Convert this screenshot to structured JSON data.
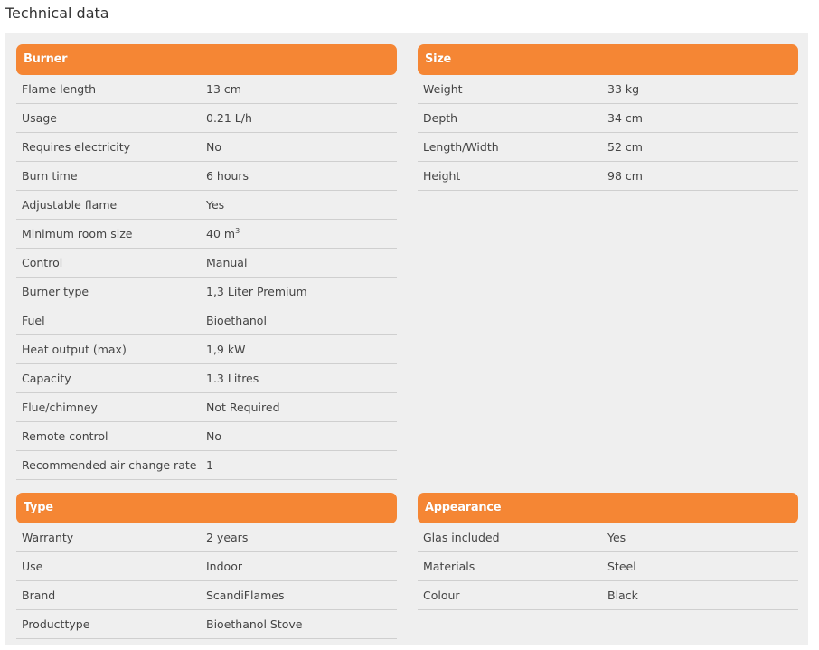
{
  "page": {
    "title": "Technical data"
  },
  "sections": {
    "burner": {
      "title": "Burner",
      "rows": [
        {
          "label": "Flame length",
          "value": "13 cm"
        },
        {
          "label": "Usage",
          "value": "0.21 L/h"
        },
        {
          "label": "Requires electricity",
          "value": "No"
        },
        {
          "label": "Burn time",
          "value": "6 hours"
        },
        {
          "label": "Adjustable flame",
          "value": "Yes"
        },
        {
          "label": "Minimum room size",
          "value": "40 m",
          "sup": "3"
        },
        {
          "label": "Control",
          "value": "Manual"
        },
        {
          "label": "Burner type",
          "value": "1,3 Liter Premium"
        },
        {
          "label": "Fuel",
          "value": "Bioethanol"
        },
        {
          "label": "Heat output (max)",
          "value": "1,9 kW"
        },
        {
          "label": "Capacity",
          "value": "1.3 Litres"
        },
        {
          "label": "Flue/chimney",
          "value": "Not Required"
        },
        {
          "label": "Remote control",
          "value": "No"
        },
        {
          "label": "Recommended air change rate",
          "value": "1"
        }
      ]
    },
    "size": {
      "title": "Size",
      "rows": [
        {
          "label": "Weight",
          "value": "33 kg"
        },
        {
          "label": "Depth",
          "value": "34 cm"
        },
        {
          "label": "Length/Width",
          "value": "52 cm"
        },
        {
          "label": "Height",
          "value": "98 cm"
        }
      ]
    },
    "type": {
      "title": "Type",
      "rows": [
        {
          "label": "Warranty",
          "value": "2 years"
        },
        {
          "label": "Use",
          "value": "Indoor"
        },
        {
          "label": "Brand",
          "value": "ScandiFlames"
        },
        {
          "label": "Producttype",
          "value": "Bioethanol Stove"
        }
      ]
    },
    "appearance": {
      "title": "Appearance",
      "rows": [
        {
          "label": "Glas included",
          "value": "Yes"
        },
        {
          "label": "Materials",
          "value": "Steel"
        },
        {
          "label": "Colour",
          "value": "Black"
        }
      ]
    }
  },
  "colors": {
    "header_bg": "#f58634",
    "panel_bg": "#efefef",
    "row_border": "#cfcfcf"
  }
}
